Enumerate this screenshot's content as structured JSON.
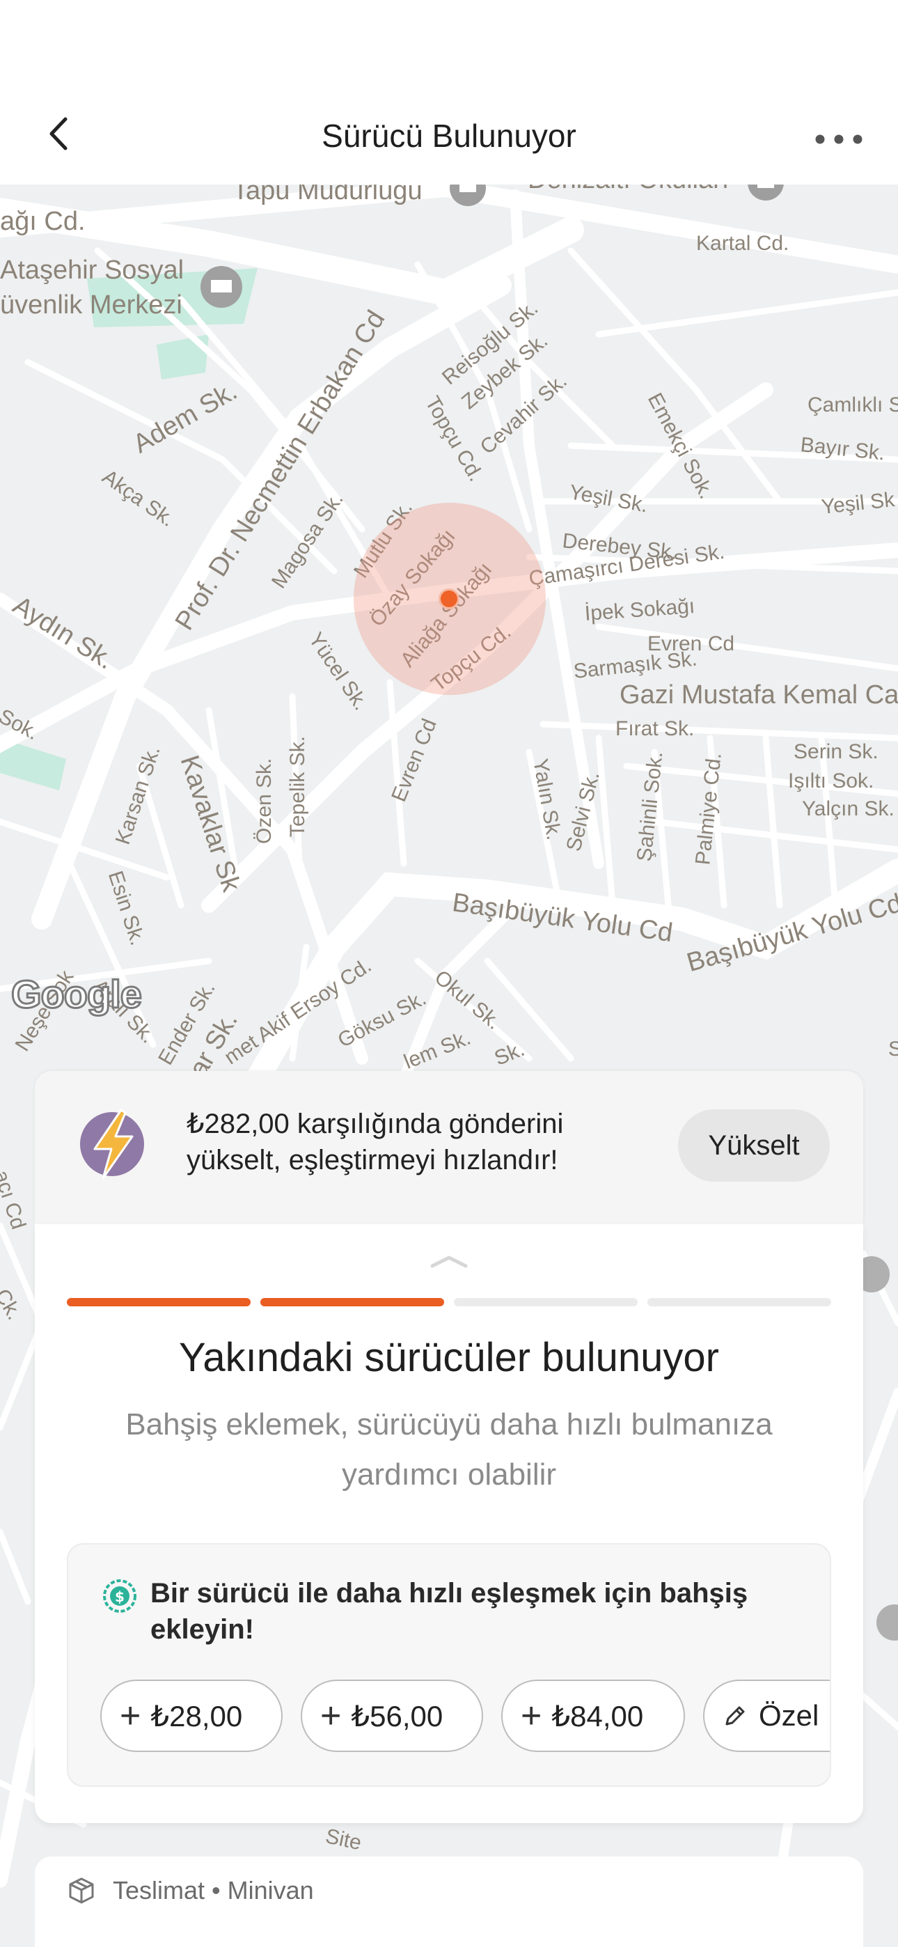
{
  "header": {
    "title": "Sürücü Bulunuyor",
    "back_icon": "chevron-left-icon",
    "more_icon": "more-horizontal-icon"
  },
  "map": {
    "labels": {
      "tapu": "Tapu Müdürlüğü",
      "denizalti": "Denizaltı Okulları",
      "cagi": "ağı Cd.",
      "kartal": "Kartal Cd.",
      "atasehir1": "Ataşehir Sosyal",
      "atasehir2": "üvenlik Merkezi",
      "adem": "Adem Sk.",
      "reisoglu": "Reisoğlu Sk.",
      "zeybek": "Zeybek Sk.",
      "cevahir": "Cevahir Sk.",
      "topcu1": "Topçu Cd.",
      "emekci": "Emekçi Sok.",
      "camlikli": "Çamlıklı S",
      "bayir": "Bayır Sk.",
      "yesil1": "Yeşil Sk.",
      "yesil2": "Yeşil Sk",
      "erbakan": "Prof. Dr. Necmettin Erbakan Cd",
      "akca": "Akça Sk.",
      "magosa": "Magosa Sk.",
      "mutlu": "Mutlu Sk.",
      "ozay": "Özay Sokağı",
      "aliaga": "Aliağa Sokağı",
      "derebey": "Derebey Sk.",
      "camasirci": "Çamaşırcı Deresi Sk.",
      "ipek": "İpek Sokağı",
      "evren1": "Evren Cd",
      "aydin": "Aydın Sk.",
      "yucel": "Yücel Sk.",
      "topcu2": "Topçu Cd.",
      "sarmasik": "Sarmaşık Sk.",
      "gazi": "Gazi Mustafa Kemal Cad",
      "firat": "Fırat Sk.",
      "sok": "Sok.",
      "kavaklar": "Kavaklar Sk",
      "evren2": "Evren Cd",
      "karsan": "Karsan Sk.",
      "ozen": "Özen Sk.",
      "tepelik": "Tepelik Sk.",
      "yalin": "Yalın Sk.",
      "selvi": "Selvi Sk.",
      "sahinli": "Şahinli Sok.",
      "palmiye": "Palmiye Cd.",
      "serin": "Serin Sk.",
      "isilti": "Işıltı Sok.",
      "yalcin": "Yalçın Sk.",
      "esin": "Esin Sk.",
      "basibuyuk1": "Başıbüyük Yolu Cd",
      "basibuyuk2": "Başıbüyük Yolu Cd",
      "nese": "Neşe Sok",
      "arali": "Aralı Sk.",
      "ender": "Ender Sk.",
      "pinar": "nar Sk.",
      "akif": "met Akif Ersoy Cd.",
      "goksu": "Göksu Sk.",
      "okul": "Okul Sk.",
      "lem": "lem Sk.",
      "sk": "Sk.",
      "site": "Site",
      "aci": "acı Cd",
      "ck": "Ck.",
      "s": "S"
    },
    "google_logo": "Google",
    "pin_icon": "location-dot-icon"
  },
  "boost": {
    "icon": "lightning-bolt-icon",
    "text": "₺282,00 karşılığında gönderini yükselt, eşleştirmeyi hızlandır!",
    "button_label": "Yükselt"
  },
  "search": {
    "progress_steps_total": 4,
    "progress_steps_done": 2,
    "title": "Yakındaki sürücüler bulunuyor",
    "subtitle": "Bahşiş eklemek, sürücüyü daha hızlı bulmanıza yardımcı olabilir"
  },
  "tip": {
    "icon": "money-coin-icon",
    "prompt": "Bir sürücü ile daha hızlı eşleşmek için bahşiş ekleyin!",
    "options": [
      {
        "label": "₺28,00",
        "icon": "plus-icon"
      },
      {
        "label": "₺56,00",
        "icon": "plus-icon"
      },
      {
        "label": "₺84,00",
        "icon": "plus-icon"
      },
      {
        "label": "Özel",
        "icon": "pencil-icon"
      }
    ]
  },
  "order": {
    "icon": "package-box-icon",
    "summary": "Teslimat • Minivan"
  },
  "colors": {
    "accent": "#ea5d23",
    "bolt_purple": "#8f79a6",
    "bolt_yellow": "#f4b63c",
    "tip_green": "#2bb39a"
  }
}
